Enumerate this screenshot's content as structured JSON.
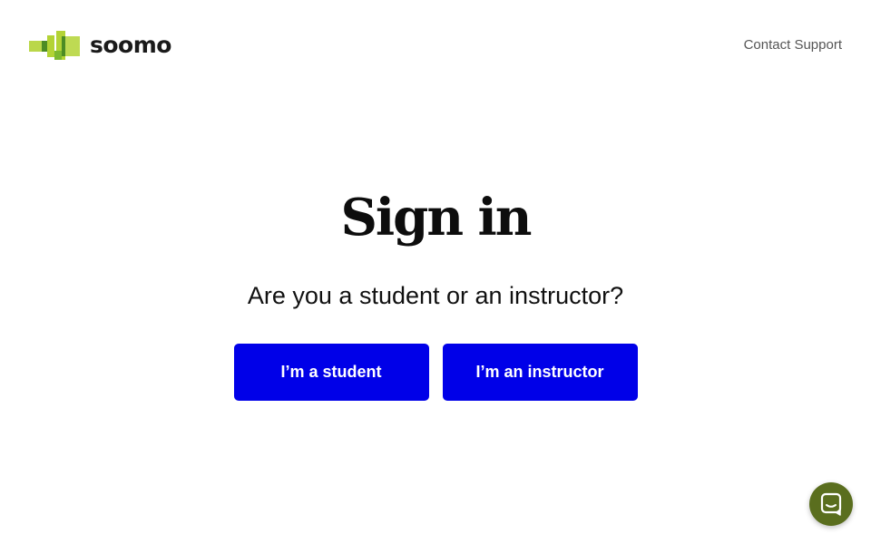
{
  "header": {
    "brand_name": "soomo",
    "contact_label": "Contact Support"
  },
  "main": {
    "title": "Sign in",
    "question": "Are you a student or an instructor?",
    "student_button": "I’m a student",
    "instructor_button": "I’m an instructor"
  },
  "chat": {
    "icon": "chat-bubble-icon"
  },
  "colors": {
    "primary_button": "#0000e8",
    "logo_green": "#b3d335",
    "logo_dark_green": "#4c8c24",
    "chat_launcher": "#5a6e1e",
    "background": "#ffffff"
  }
}
